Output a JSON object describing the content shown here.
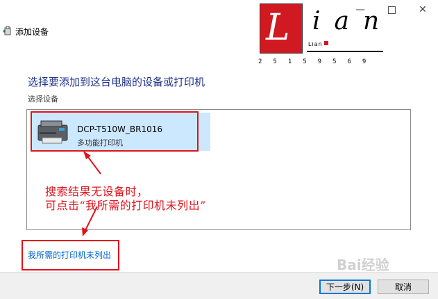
{
  "window": {
    "title": "添加设备",
    "minimize": "—",
    "close": "✕"
  },
  "main": {
    "heading": "选择要添加到这台电脑的设备或打印机",
    "subheading": "选择设备",
    "devices": [
      {
        "name": "DCP-T510W_BR1016",
        "type": "多功能打印机",
        "icon": "printer-icon",
        "selected": true
      }
    ],
    "missing_link": "我所需的打印机未列出"
  },
  "annotation": {
    "line1": "搜索结果无设备时，",
    "line2": "可点击“我所需的打印机未列出”",
    "color": "#e0121b"
  },
  "footer": {
    "next_label": "下一步(N)",
    "cancel_label": "取消"
  },
  "logo": {
    "first_letter": "L",
    "rest": "ian",
    "small_text": "Lian",
    "digits": "25159569"
  },
  "watermark": "Bai经验",
  "colors": {
    "accent": "#0078d7",
    "heading": "#1e3287",
    "link": "#0066cc",
    "selection": "#cce8ff",
    "annotation_red": "#e0121b"
  }
}
